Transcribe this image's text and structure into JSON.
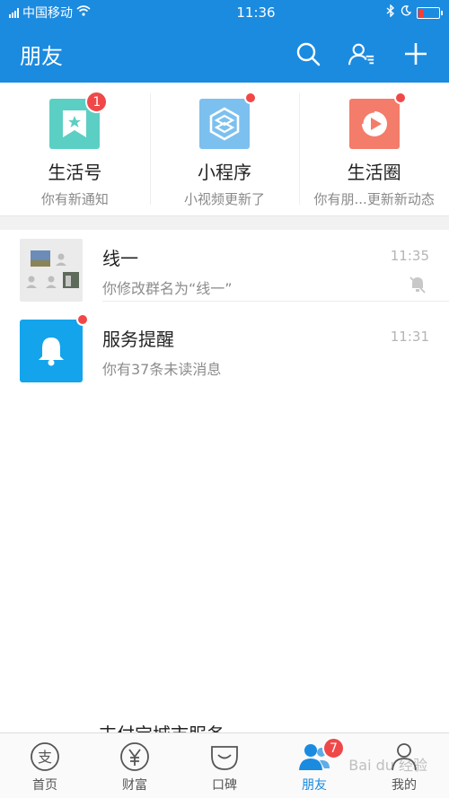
{
  "status_bar": {
    "carrier": "中国移动",
    "time": "11:36"
  },
  "header": {
    "title": "朋友"
  },
  "shortcuts": [
    {
      "name": "生活号",
      "subtitle": "你有新通知",
      "badge": "1",
      "color": "#5ccfc4"
    },
    {
      "name": "小程序",
      "subtitle": "小视频更新了",
      "color": "#7cc0ef"
    },
    {
      "name": "生活圈",
      "subtitle": "你有朋...更新新动态",
      "color": "#f47c6a"
    }
  ],
  "conversations": [
    {
      "name": "线一",
      "preview": "你修改群名为“线一”",
      "time": "11:35",
      "muted": true
    },
    {
      "name": "服务提醒",
      "preview": "你有37条未读消息",
      "time": "11:31",
      "has_dot": true
    }
  ],
  "peek_row_text": "支付宝城市服务",
  "tabs": [
    {
      "label": "首页",
      "icon": "alipay-logo-icon"
    },
    {
      "label": "财富",
      "icon": "yen-icon"
    },
    {
      "label": "口碑",
      "icon": "koubei-icon"
    },
    {
      "label": "朋友",
      "icon": "friends-icon",
      "badge": "7",
      "active": true
    },
    {
      "label": "我的",
      "icon": "person-icon"
    }
  ],
  "watermark": "Bai du 经验",
  "colors": {
    "brand_blue": "#1b8be0",
    "badge_red": "#f04848"
  }
}
